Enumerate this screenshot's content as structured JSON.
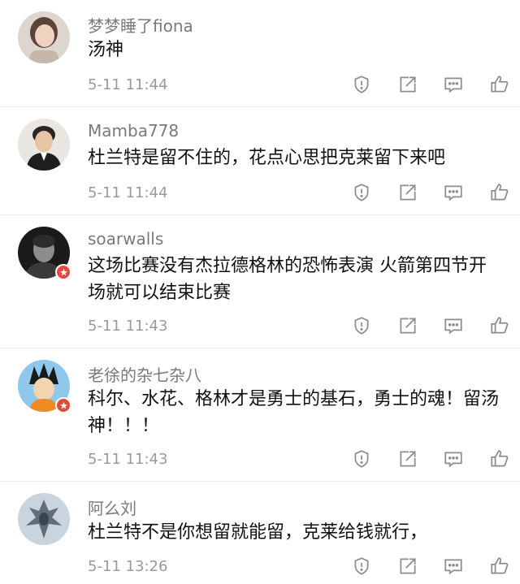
{
  "colors": {
    "username": "#7a7a7a",
    "text": "#111111",
    "timestamp": "#9a9a9a",
    "icon": "#8c8c8c",
    "badge": "#e8473b",
    "divider": "#ececec"
  },
  "action_icons": [
    "report-icon",
    "share-icon",
    "reply-icon",
    "like-icon"
  ],
  "comments": [
    {
      "username": "梦梦睡了fiona",
      "text": "汤神",
      "time": "5-11 11:44",
      "avatar": "avatar-photo-woman"
    },
    {
      "username": "Mamba778",
      "text": "杜兰特是留不住的，花点心思把克莱留下来吧",
      "time": "5-11 11:44",
      "avatar": "avatar-photo-man"
    },
    {
      "username": "soarwalls",
      "text": "这场比赛没有杰拉德格林的恐怖表演 火箭第四节开场就可以结束比赛",
      "time": "5-11 11:43",
      "avatar": "avatar-photo-bw-man"
    },
    {
      "username": "老徐的杂七杂八",
      "text": "科尔、水花、格林才是勇士的基石，勇士的魂！留汤神！！！",
      "time": "5-11 11:43",
      "avatar": "avatar-cartoon"
    },
    {
      "username": "阿么刘",
      "text": "杜兰特不是你想留就能留，克莱给钱就行，",
      "time": "5-11 13:26",
      "avatar": "avatar-dragon"
    }
  ]
}
